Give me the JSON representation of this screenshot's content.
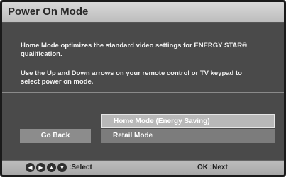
{
  "title": "Power On Mode",
  "description": {
    "paragraph1": "Home Mode optimizes the standard video settings for ENERGY STAR® qualification.",
    "paragraph2": "Use the Up and Down arrows on your remote control or TV keypad to select power on mode."
  },
  "buttons": {
    "go_back": "Go Back"
  },
  "options": [
    {
      "label": "Home Mode (Energy Saving)",
      "selected": true
    },
    {
      "label": "Retail Mode",
      "selected": false
    }
  ],
  "footer": {
    "arrow_icons": [
      "left-arrow-icon",
      "right-arrow-icon",
      "up-arrow-icon",
      "down-arrow-icon"
    ],
    "select_hint": ":Select",
    "next_hint": "OK :Next"
  }
}
